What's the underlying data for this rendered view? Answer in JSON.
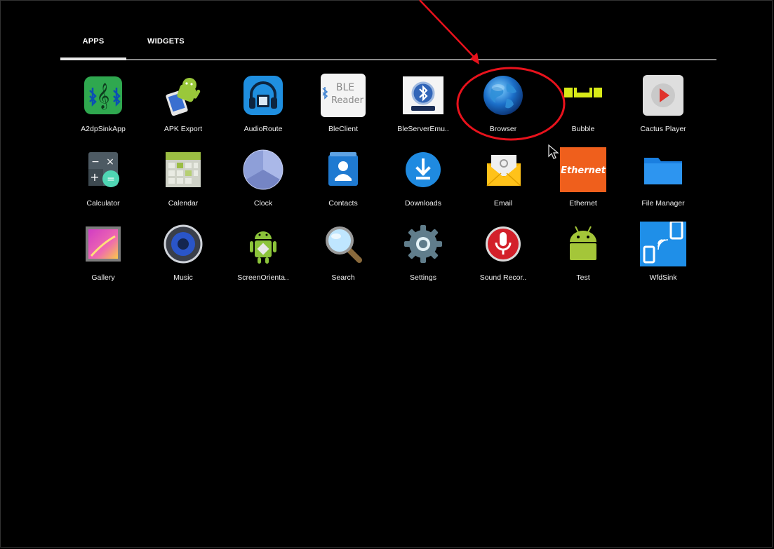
{
  "tabs": {
    "apps": "APPS",
    "widgets": "WIDGETS"
  },
  "apps": [
    {
      "label": "A2dpSinkApp",
      "icon": "bluetooth-music-icon"
    },
    {
      "label": "APK Export",
      "icon": "android-apk-icon"
    },
    {
      "label": "AudioRoute",
      "icon": "headphones-icon"
    },
    {
      "label": "BleClient",
      "icon": "ble-reader-icon",
      "icon_text": [
        "BLE",
        "Reader"
      ]
    },
    {
      "label": "BleServerEmu..",
      "icon": "bluetooth-server-icon"
    },
    {
      "label": "Browser",
      "icon": "globe-icon"
    },
    {
      "label": "Bubble",
      "icon": "level-bubble-icon"
    },
    {
      "label": "Cactus Player",
      "icon": "play-button-icon"
    },
    {
      "label": "Calculator",
      "icon": "calculator-icon"
    },
    {
      "label": "Calendar",
      "icon": "calendar-icon"
    },
    {
      "label": "Clock",
      "icon": "clock-icon"
    },
    {
      "label": "Contacts",
      "icon": "contacts-icon"
    },
    {
      "label": "Downloads",
      "icon": "download-icon"
    },
    {
      "label": "Email",
      "icon": "envelope-icon"
    },
    {
      "label": "Ethernet",
      "icon": "ethernet-icon",
      "icon_text": [
        "Ethernet"
      ]
    },
    {
      "label": "File Manager",
      "icon": "folder-icon"
    },
    {
      "label": "Gallery",
      "icon": "gallery-icon"
    },
    {
      "label": "Music",
      "icon": "speaker-icon"
    },
    {
      "label": "ScreenOrienta..",
      "icon": "android-orientation-icon"
    },
    {
      "label": "Search",
      "icon": "magnifier-icon"
    },
    {
      "label": "Settings",
      "icon": "gear-icon"
    },
    {
      "label": "Sound Recor..",
      "icon": "microphone-icon"
    },
    {
      "label": "Test",
      "icon": "android-icon"
    },
    {
      "label": "WfdSink",
      "icon": "wireless-display-icon"
    }
  ],
  "colors": {
    "background": "#000000",
    "annotation": "#e8121c"
  }
}
